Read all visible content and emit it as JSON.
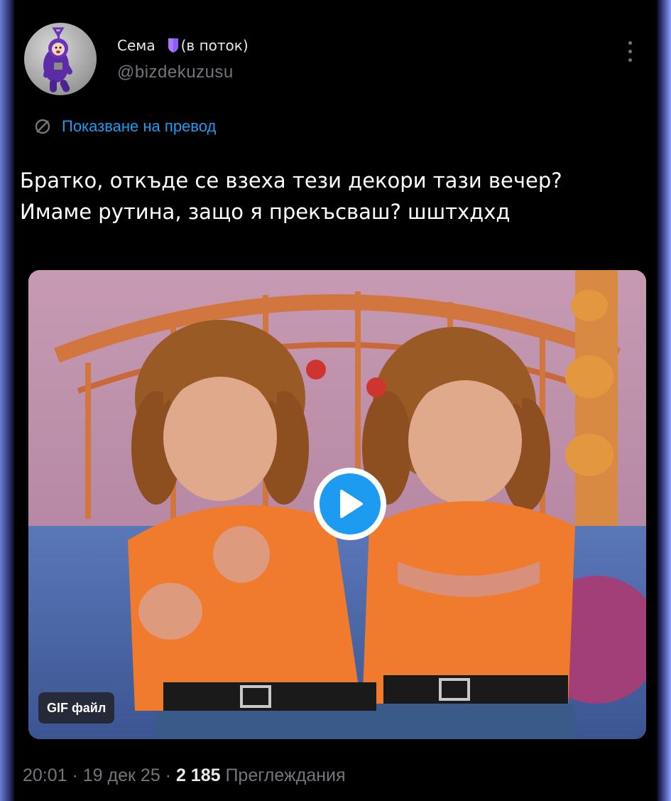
{
  "author": {
    "display_name": "Сема",
    "status": "(в поток)",
    "handle": "@bizdekuzusu",
    "badge_color": "#8f5cff"
  },
  "translate": {
    "label": "Показване на превод",
    "icon": "translate-icon",
    "color": "#1d9bf0"
  },
  "tweet": {
    "text": "Братко, откъде се взеха тези декори тази вечер?\nИмаме рутина, защо я прекъсваш? шштхдхд"
  },
  "media": {
    "badge_label": "GIF файл",
    "play_icon": "play-icon",
    "play_color": "#1d9bf0"
  },
  "meta": {
    "time": "20:01",
    "date": "19 дек 25",
    "views_count": "2 185",
    "views_label": "Преглеждания",
    "separator": " · "
  },
  "menu": {
    "icon": "more-vertical-icon"
  }
}
